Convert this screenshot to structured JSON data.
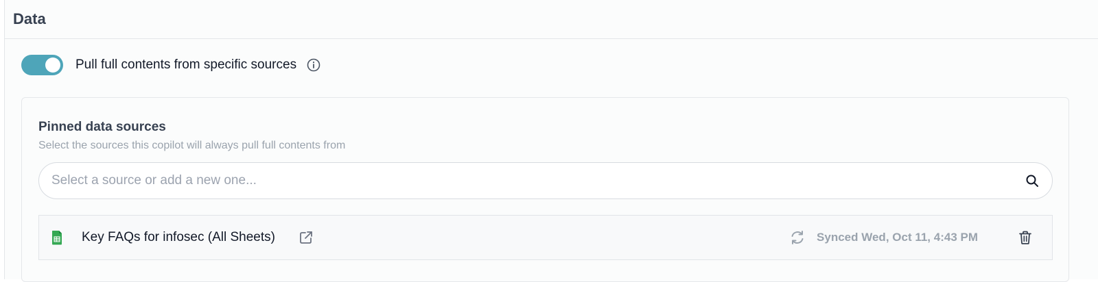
{
  "header": {
    "title": "Data"
  },
  "toggle": {
    "label": "Pull full contents from specific sources",
    "on": true
  },
  "pinned": {
    "title": "Pinned data sources",
    "subtitle": "Select the sources this copilot will always pull full contents from",
    "search": {
      "placeholder": "Select a source or add a new one...",
      "value": ""
    },
    "sources": [
      {
        "name": "Key FAQs for infosec (All Sheets)",
        "sync_status": "Synced Wed, Oct 11, 4:43 PM",
        "icon": "google-sheets-icon"
      }
    ]
  },
  "colors": {
    "accent": "#4ea5b9",
    "sheets_green": "#34a853",
    "muted": "#9aa3ad"
  }
}
